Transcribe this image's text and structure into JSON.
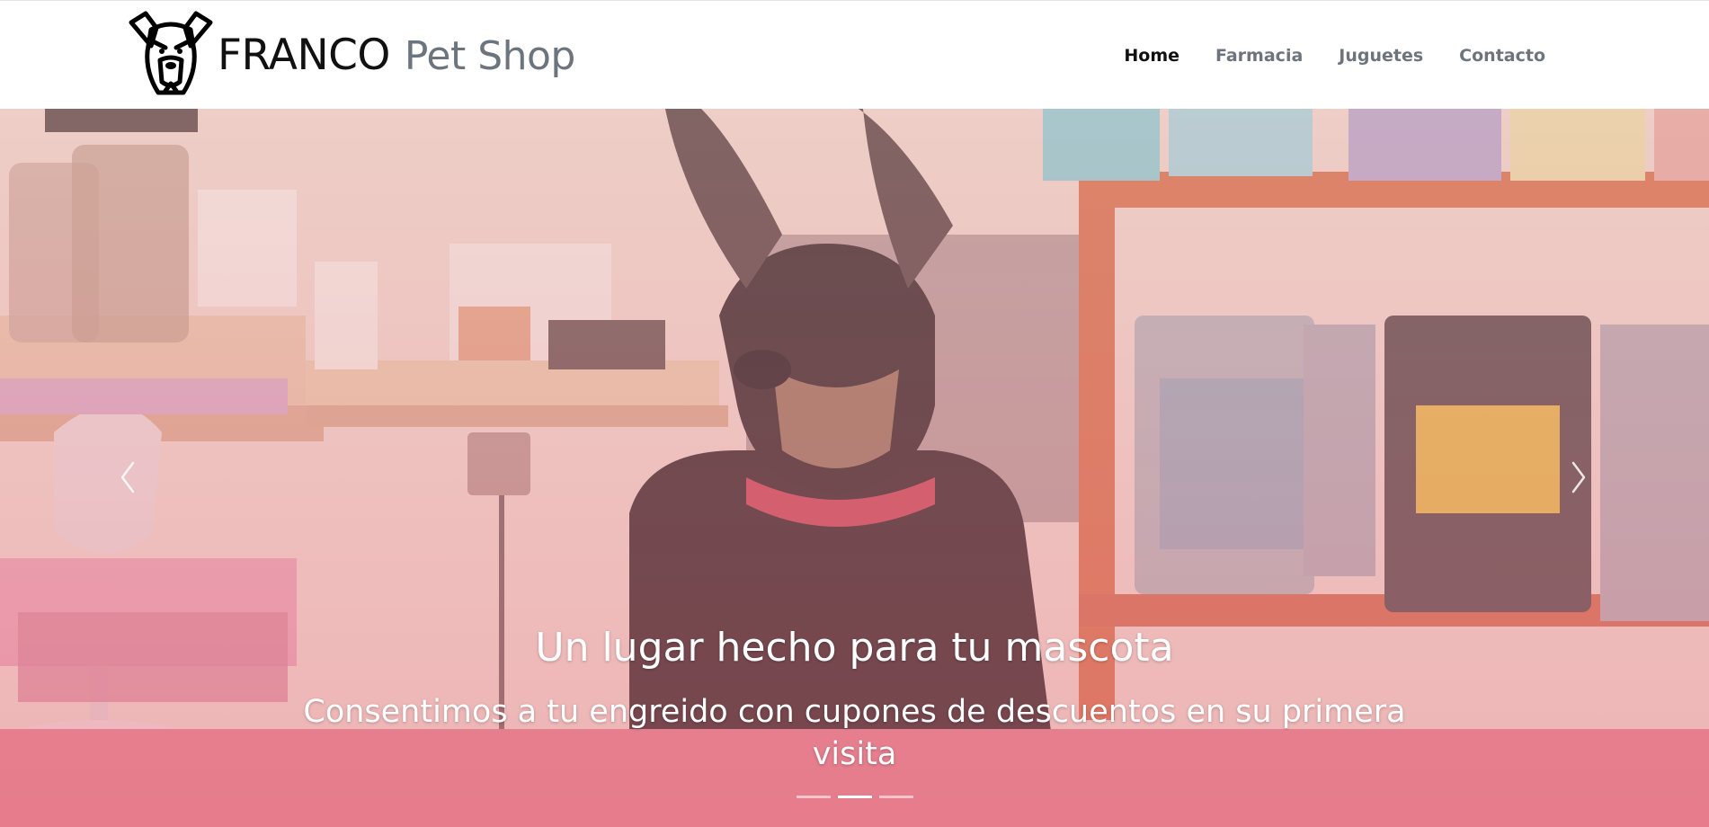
{
  "brand": {
    "logo_icon": "schnauzer-dog-icon",
    "name": "FRANCO",
    "subtitle": "Pet Shop"
  },
  "nav": {
    "items": [
      {
        "label": "Home",
        "active": true
      },
      {
        "label": "Farmacia",
        "active": false
      },
      {
        "label": "Juguetes",
        "active": false
      },
      {
        "label": "Contacto",
        "active": false
      }
    ]
  },
  "carousel": {
    "prev_icon": "chevron-left-icon",
    "next_icon": "chevron-right-icon",
    "slide": {
      "title": "Un lugar hecho para tu mascota",
      "subtitle_line1": "Consentimos a tu engreido con cupones de descuentos en su primera",
      "subtitle_line2": "visita"
    },
    "indicator_count": 3,
    "active_indicator": 2
  },
  "colors": {
    "nav_active": "#111111",
    "nav_inactive": "#6c757d",
    "overlay_tint": "#ea7f8f"
  }
}
